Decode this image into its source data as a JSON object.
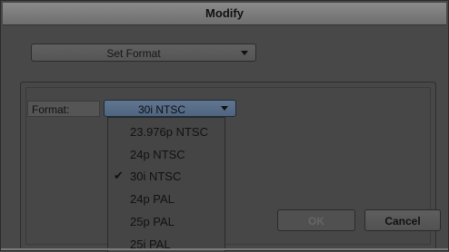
{
  "window": {
    "title": "Modify"
  },
  "set_format": {
    "label": "Set Format"
  },
  "format": {
    "label": "Format:",
    "selected": "30i NTSC",
    "options": [
      {
        "label": "23.976p NTSC",
        "checked": false
      },
      {
        "label": "24p NTSC",
        "checked": false
      },
      {
        "label": "30i NTSC",
        "checked": true
      },
      {
        "label": "24p PAL",
        "checked": false
      },
      {
        "label": "25p PAL",
        "checked": false
      },
      {
        "label": "25i PAL",
        "checked": false
      }
    ]
  },
  "buttons": {
    "ok": "OK",
    "cancel": "Cancel"
  },
  "colors": {
    "selected_field": "#5f7590"
  }
}
